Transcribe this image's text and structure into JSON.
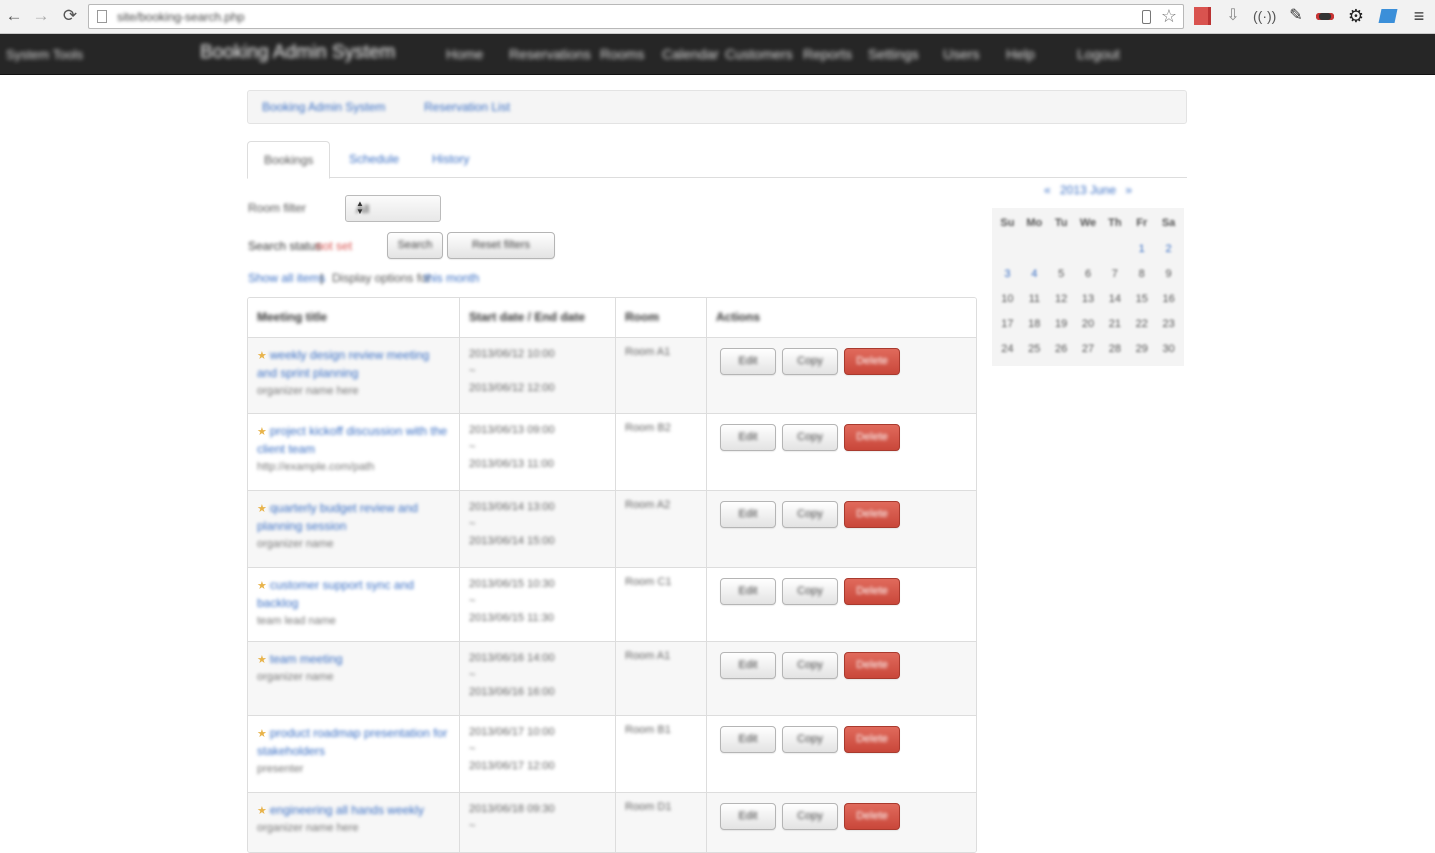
{
  "browser": {
    "url": "site/booking-search.php",
    "back_icon": "←",
    "forward_icon": "→",
    "reload_icon": "⟳",
    "star_icon": "☆",
    "menu_icon": "≡",
    "download_icon": "⇩",
    "wave_icon": "((·))",
    "dropper_icon": "✎",
    "gear_icon": "⚙"
  },
  "navbar": {
    "left_text": "System Tools",
    "brand": "Booking Admin System",
    "links": [
      "Home",
      "Reservations",
      "Rooms",
      "Calendar",
      "Customers",
      "Reports",
      "Settings",
      "Users",
      "Help",
      "Logout"
    ]
  },
  "breadcrumb": {
    "root": "Booking Admin System",
    "current": "Reservation List"
  },
  "tabs": [
    "Bookings",
    "Schedule",
    "History"
  ],
  "filters": {
    "room_label": "Room filter",
    "room_value": "All",
    "status_label": "Search status",
    "status_value": "not set",
    "search_button": "Search",
    "reset_button": "Reset filters"
  },
  "links": {
    "left": "Show all items",
    "separator": "|",
    "middle": "Display options for",
    "right": "this month"
  },
  "table": {
    "headers": [
      "Meeting title",
      "Start date / End date",
      "Room",
      "Actions"
    ],
    "rows": [
      {
        "star": "★",
        "title": "weekly design review meeting and sprint planning",
        "sub": "organizer name here",
        "start": "2013/06/12 10:00",
        "mid": "~",
        "end": "2013/06/12 12:00",
        "room": "Room A1",
        "b1": "Edit",
        "b2": "Copy",
        "b3": "Delete"
      },
      {
        "star": "★",
        "title": "project kickoff discussion with the client team",
        "sub": "http://example.com/path",
        "start": "2013/06/13 09:00",
        "mid": "~",
        "end": "2013/06/13 11:00",
        "room": "Room B2",
        "b1": "Edit",
        "b2": "Copy",
        "b3": "Delete"
      },
      {
        "star": "★",
        "title": "quarterly budget review and planning session",
        "sub": "organizer name",
        "start": "2013/06/14 13:00",
        "mid": "~",
        "end": "2013/06/14 15:00",
        "room": "Room A2",
        "b1": "Edit",
        "b2": "Copy",
        "b3": "Delete"
      },
      {
        "star": "★",
        "title": "customer support sync and backlog",
        "sub": "team lead name",
        "start": "2013/06/15 10:30",
        "mid": "~",
        "end": "2013/06/15 11:30",
        "room": "Room C1",
        "b1": "Edit",
        "b2": "Copy",
        "b3": "Delete"
      },
      {
        "star": "★",
        "title": "team meeting",
        "sub": "organizer name",
        "start": "2013/06/16 14:00",
        "mid": "~",
        "end": "2013/06/16 16:00",
        "room": "Room A1",
        "b1": "Edit",
        "b2": "Copy",
        "b3": "Delete"
      },
      {
        "star": "★",
        "title": "product roadmap presentation for stakeholders",
        "sub": "presenter",
        "start": "2013/06/17 10:00",
        "mid": "~",
        "end": "2013/06/17 12:00",
        "room": "Room B1",
        "b1": "Edit",
        "b2": "Copy",
        "b3": "Delete"
      },
      {
        "star": "★",
        "title": "engineering all hands weekly",
        "sub": "organizer name here",
        "start": "2013/06/18 09:30",
        "mid": "~",
        "end": "",
        "room": "Room D1",
        "b1": "Edit",
        "b2": "Copy",
        "b3": "Delete"
      }
    ]
  },
  "calendar": {
    "prev": "«",
    "month": "2013 June",
    "next": "»",
    "dow": [
      "Su",
      "Mo",
      "Tu",
      "We",
      "Th",
      "Fr",
      "Sa"
    ],
    "weeks": [
      [
        "",
        "",
        "",
        "",
        "",
        "1",
        "2"
      ],
      [
        "3",
        "4",
        "5",
        "6",
        "7",
        "8",
        "9"
      ],
      [
        "10",
        "11",
        "12",
        "13",
        "14",
        "15",
        "16"
      ],
      [
        "17",
        "18",
        "19",
        "20",
        "21",
        "22",
        "23"
      ],
      [
        "24",
        "25",
        "26",
        "27",
        "28",
        "29",
        "30"
      ]
    ]
  }
}
